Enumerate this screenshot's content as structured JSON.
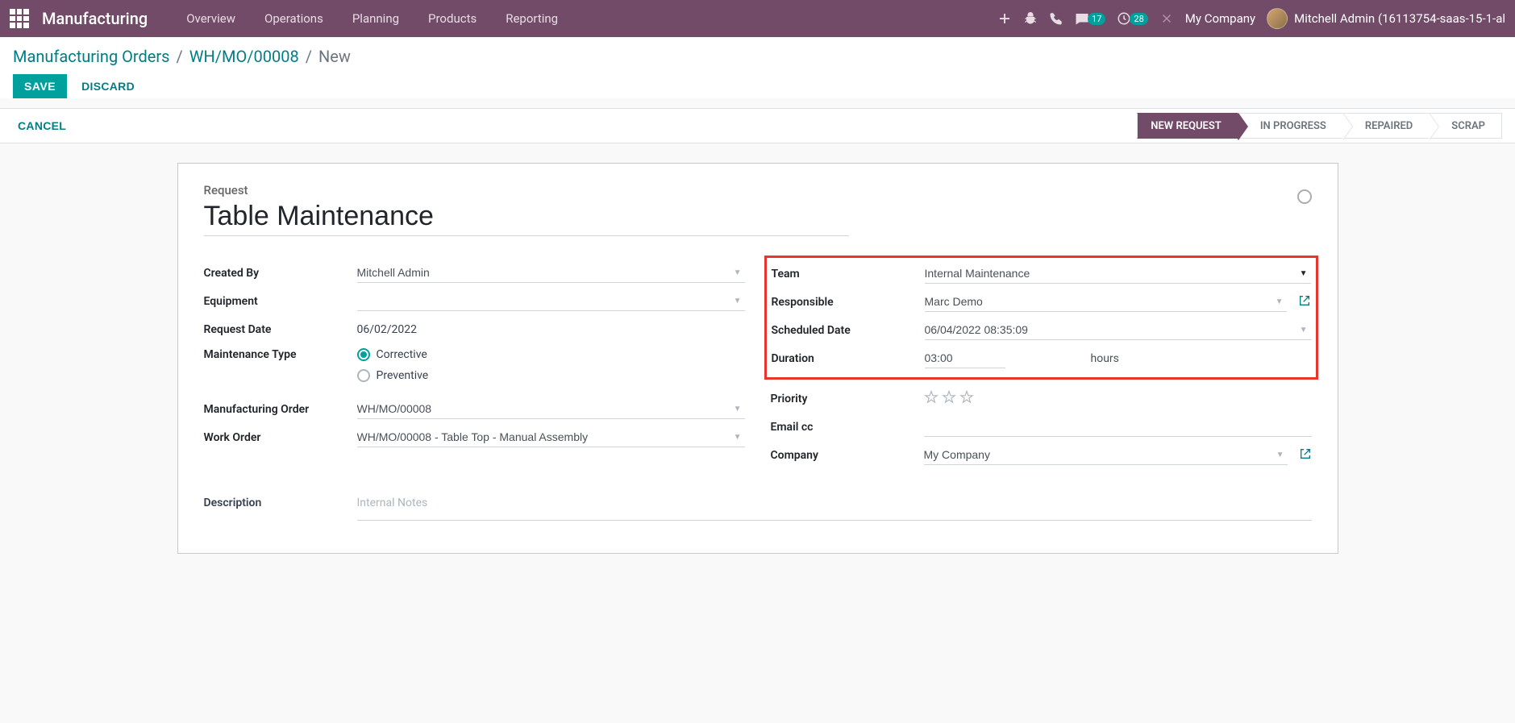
{
  "topnav": {
    "brand": "Manufacturing",
    "items": [
      "Overview",
      "Operations",
      "Planning",
      "Products",
      "Reporting"
    ],
    "company": "My Company",
    "user": "Mitchell Admin (16113754-saas-15-1-al",
    "messages_count": "17",
    "activities_count": "28"
  },
  "breadcrumb": {
    "items": [
      "Manufacturing Orders",
      "WH/MO/00008"
    ],
    "current": "New"
  },
  "buttons": {
    "save": "SAVE",
    "discard": "DISCARD",
    "cancel": "CANCEL"
  },
  "status": {
    "steps": [
      "NEW REQUEST",
      "IN PROGRESS",
      "REPAIRED",
      "SCRAP"
    ],
    "active_index": 0
  },
  "form": {
    "title_label": "Request",
    "title_value": "Table Maintenance",
    "left": {
      "created_by": {
        "label": "Created By",
        "value": "Mitchell Admin"
      },
      "equipment": {
        "label": "Equipment",
        "value": ""
      },
      "request_date": {
        "label": "Request Date",
        "value": "06/02/2022"
      },
      "maintenance_type": {
        "label": "Maintenance Type",
        "options": [
          "Corrective",
          "Preventive"
        ],
        "selected": 0
      },
      "manufacturing_order": {
        "label": "Manufacturing Order",
        "value": "WH/MO/00008"
      },
      "work_order": {
        "label": "Work Order",
        "value": "WH/MO/00008 - Table Top - Manual Assembly"
      },
      "description": {
        "label": "Description",
        "placeholder": "Internal Notes"
      }
    },
    "right": {
      "team": {
        "label": "Team",
        "value": "Internal Maintenance"
      },
      "responsible": {
        "label": "Responsible",
        "value": "Marc Demo"
      },
      "scheduled_date": {
        "label": "Scheduled Date",
        "value": "06/04/2022 08:35:09"
      },
      "duration": {
        "label": "Duration",
        "value": "03:00",
        "unit": "hours"
      },
      "priority": {
        "label": "Priority"
      },
      "email_cc": {
        "label": "Email cc",
        "value": ""
      },
      "company": {
        "label": "Company",
        "value": "My Company"
      }
    }
  }
}
